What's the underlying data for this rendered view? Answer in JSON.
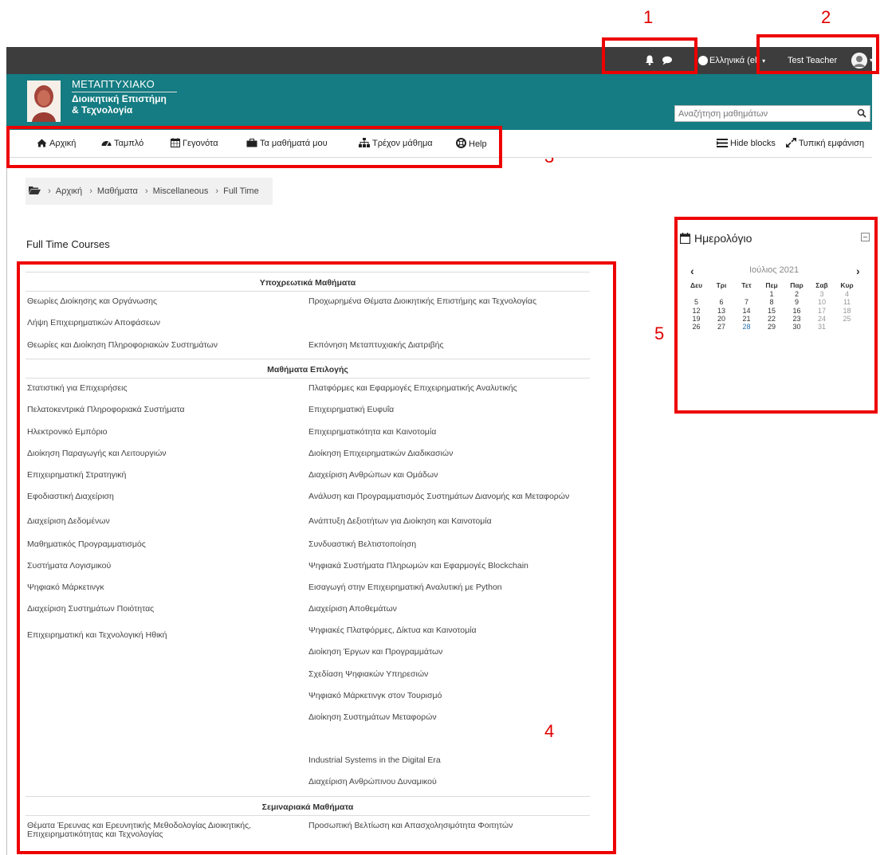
{
  "annotations": [
    "1",
    "2",
    "3",
    "4",
    "5"
  ],
  "topbar": {
    "language": "Ελληνικά (el)",
    "user_name": "Test Teacher"
  },
  "header": {
    "logo_line1": "ΜΕΤΑΠΤΥΧΙΑΚΟ",
    "logo_line2": "Διοικητική Επιστήμη",
    "logo_line3": "& Τεχνολογία",
    "search_placeholder": "Αναζήτηση μαθημάτων"
  },
  "nav": {
    "items": [
      "Αρχική",
      "Ταμπλό",
      "Γεγονότα",
      "Τα μαθήματά μου",
      "Τρέχον μάθημα",
      "Help"
    ],
    "hide_blocks": "Hide blocks",
    "standard_view": "Τυπική εμφάνιση"
  },
  "breadcrumb": [
    "Αρχική",
    "Μαθήματα",
    "Miscellaneous",
    "Full Time"
  ],
  "page_heading": "Full Time Courses",
  "courses": {
    "required": {
      "title": "Υποχρεωτικά Μαθήματα",
      "left": [
        "Θεωρίες Διοίκησης και Οργάνωσης",
        "Λήψη Επιχειρηματικών Αποφάσεων",
        "Θεωρίες και Διοίκηση Πληροφοριακών Συστημάτων"
      ],
      "right": [
        "Προχωρημένα Θέματα Διοικητικής Επιστήμης και Τεχνολογίας",
        "Εκπόνηση Μεταπτυχιακής Διατριβής"
      ]
    },
    "electives": {
      "title": "Μαθήματα Επιλογής",
      "left": [
        "Στατιστική για Επιχειρήσεις",
        "Πελατοκεντρικά Πληροφοριακά Συστήματα",
        "Ηλεκτρονικό Εμπόριο",
        "Διοίκηση Παραγωγής και Λειτουργιών",
        "Επιχειρηματική Στρατηγική",
        "Εφοδιαστική Διαχείριση",
        "Διαχείριση Δεδομένων",
        "Μαθηματικός Προγραμματισμός",
        "Συστήματα Λογισμικού",
        "Ψηφιακό Μάρκετινγκ",
        "Διαχείριση Συστημάτων Ποιότητας",
        "Επιχειρηματική και Τεχνολογική Ηθική"
      ],
      "right": [
        "Πλατφόρμες και Εφαρμογές Επιχειρηματικής Αναλυτικής",
        "Επιχειρηματική Ευφυΐα",
        "Επιχειρηματικότητα και Καινοτομία",
        "Διοίκηση Επιχειρηματικών Διαδικασιών",
        "Διαχείριση Ανθρώπων και Ομάδων",
        "Ανάλυση και Προγραμματισμός Συστημάτων Διανομής και Μεταφορών",
        "Ανάπτυξη Δεξιοτήτων για Διοίκηση και Καινοτομία",
        "Συνδυαστική Βελτιστοποίηση",
        "Ψηφιακά Συστήματα Πληρωμών και Εφαρμογές Blockchain",
        "Εισαγωγή στην Επιχειρηματική Αναλυτική με Python",
        "Διαχείριση Αποθεμάτων",
        "Ψηφιακές Πλατφόρμες, Δίκτυα και Καινοτομία",
        "Διοίκηση Έργων και Προγραμμάτων",
        "Σχεδίαση Ψηφιακών Υπηρεσιών",
        "Ψηφιακό Μάρκετινγκ στον Τουρισμό",
        "Διοίκηση Συστημάτων Μεταφορών",
        "Industrial Systems in the Digital Era",
        "Διαχείριση Ανθρώπινου Δυναμικού"
      ]
    },
    "seminars": {
      "title": "Σεμιναριακά Μαθήματα",
      "left": [
        "Θέματα Έρευνας και Ερευνητικής Μεθοδολογίας Διοικητικής, Επιχειρηματικότητας και Τεχνολογίας"
      ],
      "right": [
        "Προσωπική Βελτίωση και Απασχολησιμότητα Φοιτητών"
      ]
    }
  },
  "calendar": {
    "title": "Ημερολόγιο",
    "month": "Ιούλιος 2021",
    "weekdays": [
      "Δευ",
      "Τρι",
      "Τετ",
      "Πεμ",
      "Παρ",
      "Σαβ",
      "Κυρ"
    ],
    "weeks": [
      [
        "",
        "",
        "",
        "1",
        "2",
        "3",
        "4"
      ],
      [
        "5",
        "6",
        "7",
        "8",
        "9",
        "10",
        "11"
      ],
      [
        "12",
        "13",
        "14",
        "15",
        "16",
        "17",
        "18"
      ],
      [
        "19",
        "20",
        "21",
        "22",
        "23",
        "24",
        "25"
      ],
      [
        "26",
        "27",
        "28",
        "29",
        "30",
        "31",
        ""
      ]
    ],
    "today": "28"
  },
  "colors": {
    "header_teal": "#147c82",
    "topbar_dark": "#3d3d3d",
    "annotation_red": "#ee0000"
  }
}
